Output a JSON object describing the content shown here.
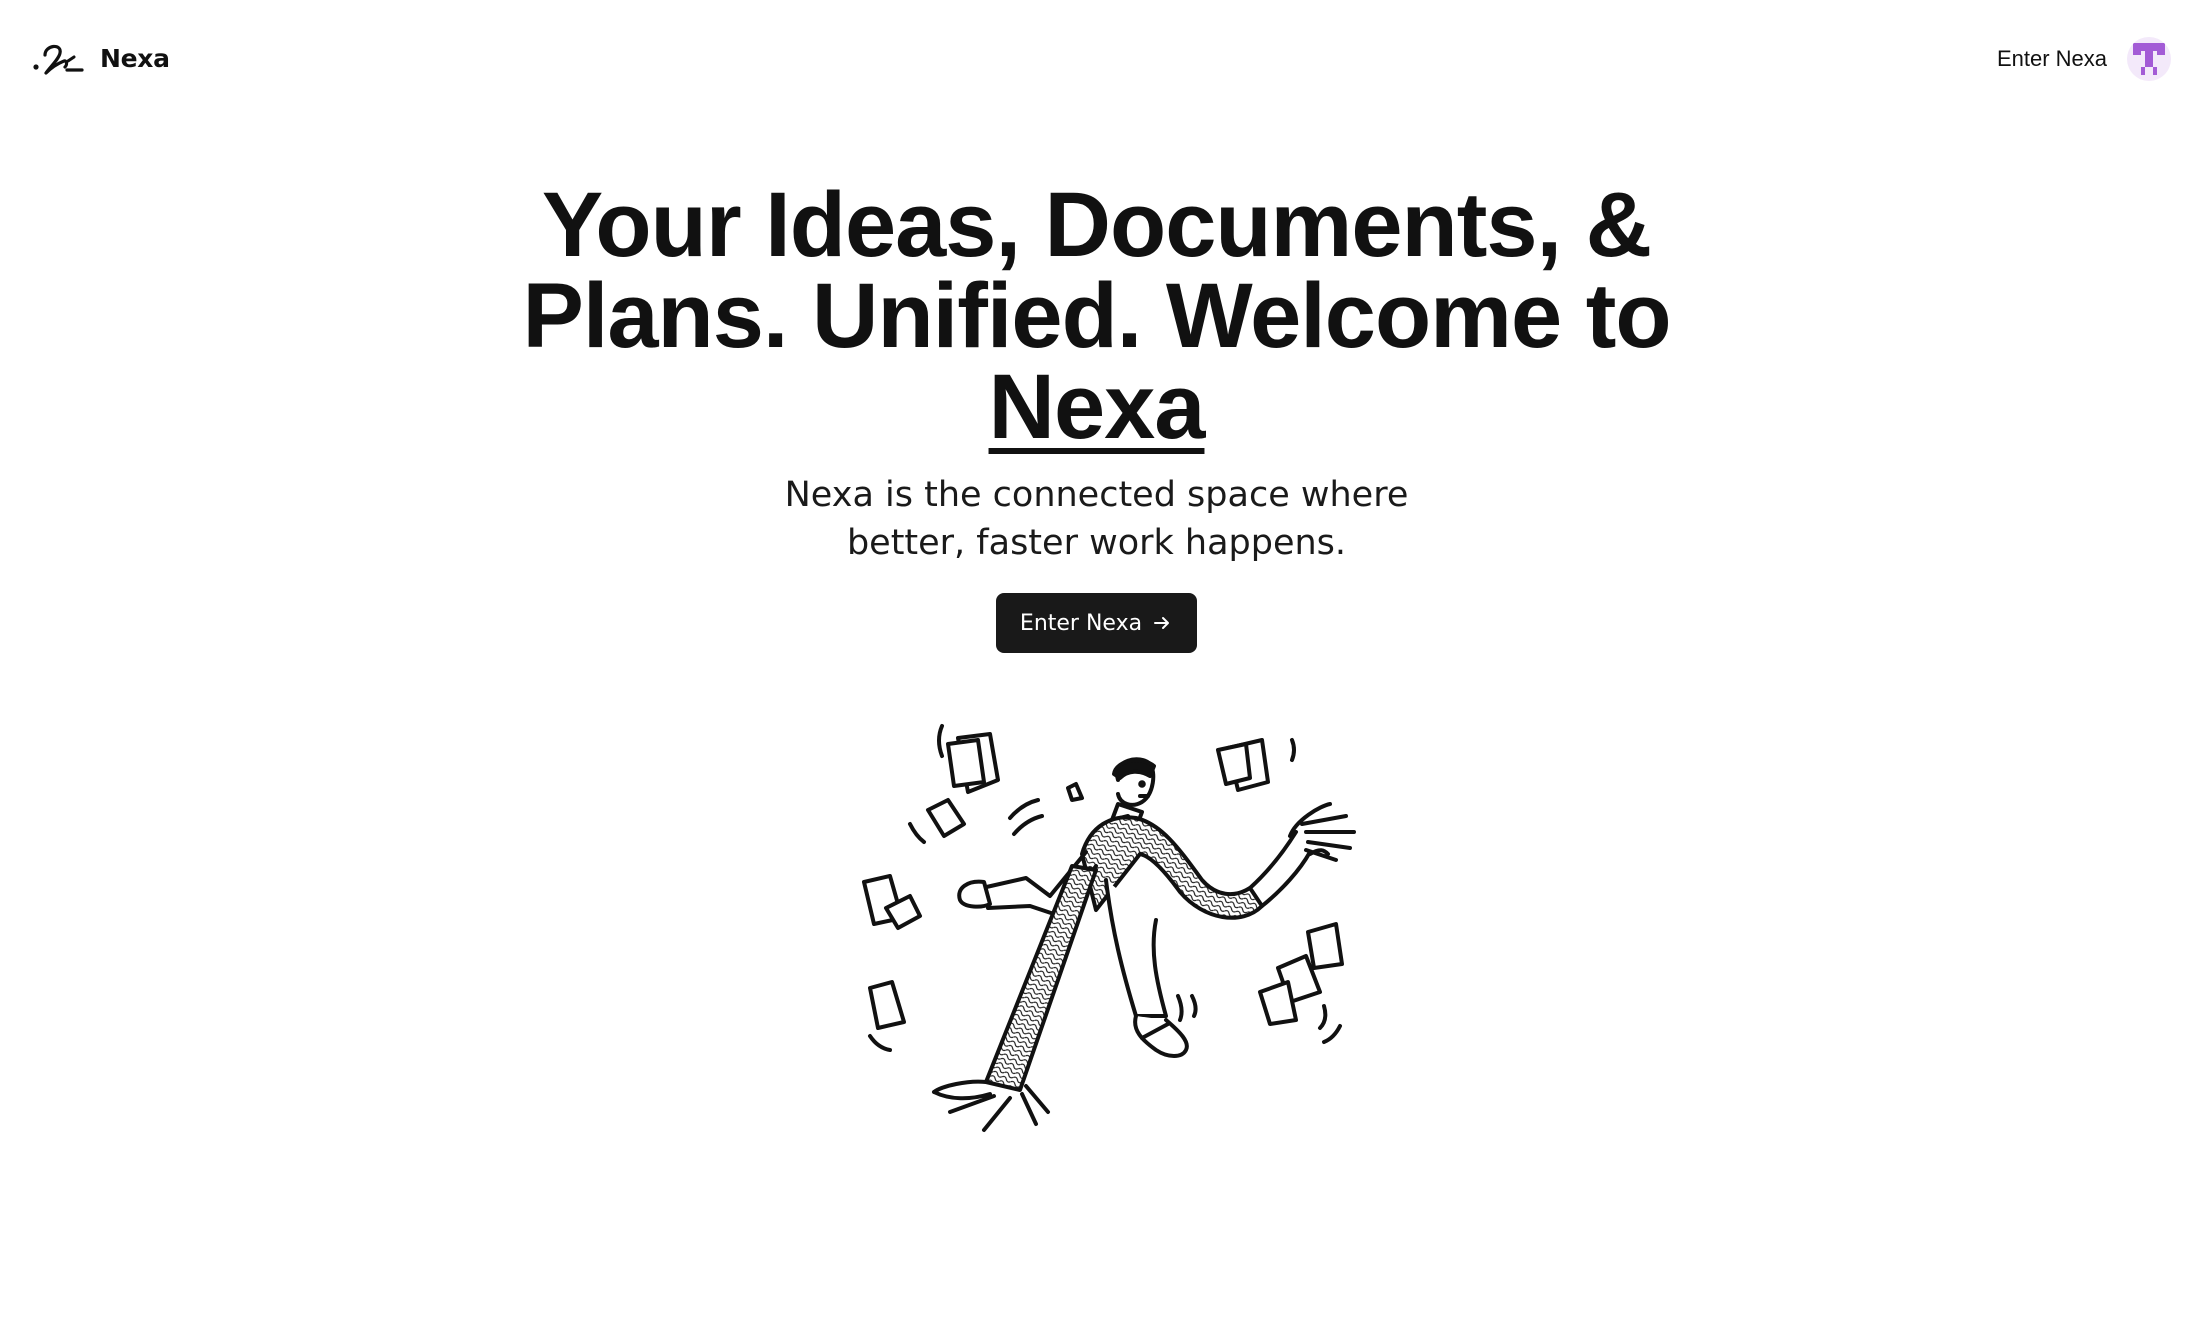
{
  "nav": {
    "brand_name": "Nexa",
    "enter_link": "Enter Nexa",
    "logo_icon": "nexa-signature-logo",
    "avatar_icon": "pixel-avatar-icon"
  },
  "hero": {
    "title_main": "Your Ideas, Documents, & Plans. Unified. Welcome to",
    "title_brand": "Nexa",
    "subtitle": "Nexa is the connected space where better, faster work happens.",
    "cta_label": "Enter Nexa",
    "cta_icon": "arrow-right-icon"
  },
  "illustration": {
    "icon": "juggling-papers-person-illustration"
  },
  "colors": {
    "background": "#ffffff",
    "text": "#111111",
    "button_bg": "#191919",
    "button_text": "#ffffff",
    "avatar_accent": "#a35bd6"
  }
}
